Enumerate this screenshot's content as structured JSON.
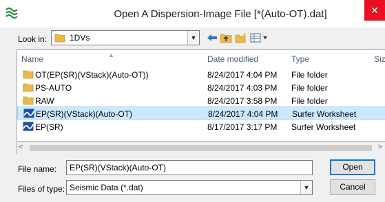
{
  "window": {
    "title": "Open A Dispersion-Image File [*(Auto-OT).dat]",
    "close_glyph": "✕"
  },
  "look_in": {
    "label": "Look in:",
    "value": "1DVs"
  },
  "columns": [
    {
      "label": "Name"
    },
    {
      "label": "Date modified"
    },
    {
      "label": "Type"
    },
    {
      "label": "Siz"
    }
  ],
  "files": [
    {
      "name": "OT(EP(SR)(VStack)(Auto-OT))",
      "date": "8/24/2017 4:04 PM",
      "type": "File folder",
      "icon": "folder-icon"
    },
    {
      "name": "PS-AUTO",
      "date": "8/24/2017 4:03 PM",
      "type": "File folder",
      "icon": "folder-icon"
    },
    {
      "name": "RAW",
      "date": "8/24/2017 3:58 PM",
      "type": "File folder",
      "icon": "folder-icon"
    },
    {
      "name": "EP(SR)(VStack)(Auto-OT)",
      "date": "8/24/2017 4:04 PM",
      "type": "Surfer Worksheet",
      "icon": "surfer-worksheet-icon",
      "selected": true
    },
    {
      "name": "EP(SR)",
      "date": "8/17/2017 3:17 PM",
      "type": "Surfer Worksheet",
      "icon": "surfer-worksheet-icon"
    }
  ],
  "file_name": {
    "label": "File name:",
    "value": "EP(SR)(VStack)(Auto-OT)"
  },
  "file_type": {
    "label": "Files of type:",
    "value": "Seismic Data (*.dat)"
  },
  "buttons": {
    "open": "Open",
    "cancel": "Cancel"
  },
  "colors": {
    "selection": "#cce8ff",
    "close": "#e81123",
    "folder": "#e8b94a"
  }
}
